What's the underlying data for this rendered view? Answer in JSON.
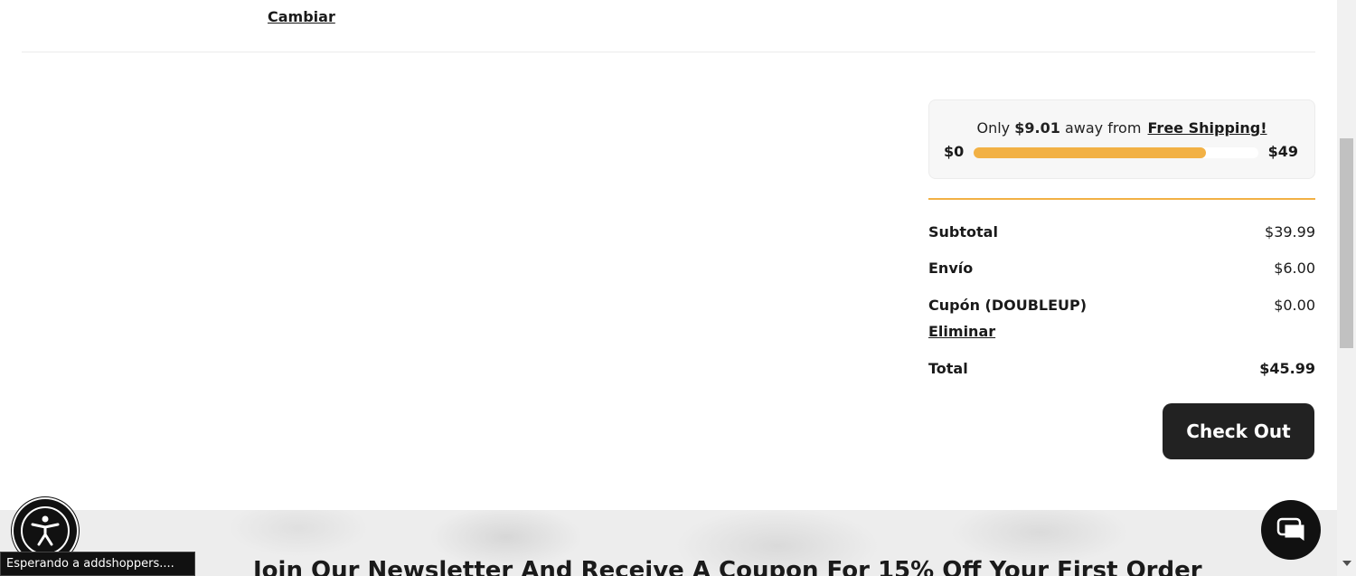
{
  "address": {
    "change_label": "Cambiar"
  },
  "shipping": {
    "prefix": "Only",
    "amount": "$9.01",
    "middle": "away from",
    "link": "Free Shipping!",
    "min": "$0",
    "max": "$49",
    "progress_fraction": 0.816,
    "bar_color": "#f2b145"
  },
  "summary": {
    "subtotal_label": "Subtotal",
    "subtotal_value": "$39.99",
    "shipping_label": "Envío",
    "shipping_value": "$6.00",
    "coupon_label": "Cupón (DOUBLEUP)",
    "coupon_value": "$0.00",
    "remove_label": "Eliminar",
    "total_label": "Total",
    "total_value": "$45.99"
  },
  "checkout_label": "Check Out",
  "newsletter": {
    "title": "Join Our Newsletter And Receive A Coupon For 15% Off Your First Order"
  },
  "status_text": "Esperando a addshoppers....",
  "icons": {
    "accessibility": "accessibility-icon",
    "chat": "chat-bubble-icon"
  },
  "colors": {
    "accent": "#f2b145",
    "button": "#222222"
  }
}
